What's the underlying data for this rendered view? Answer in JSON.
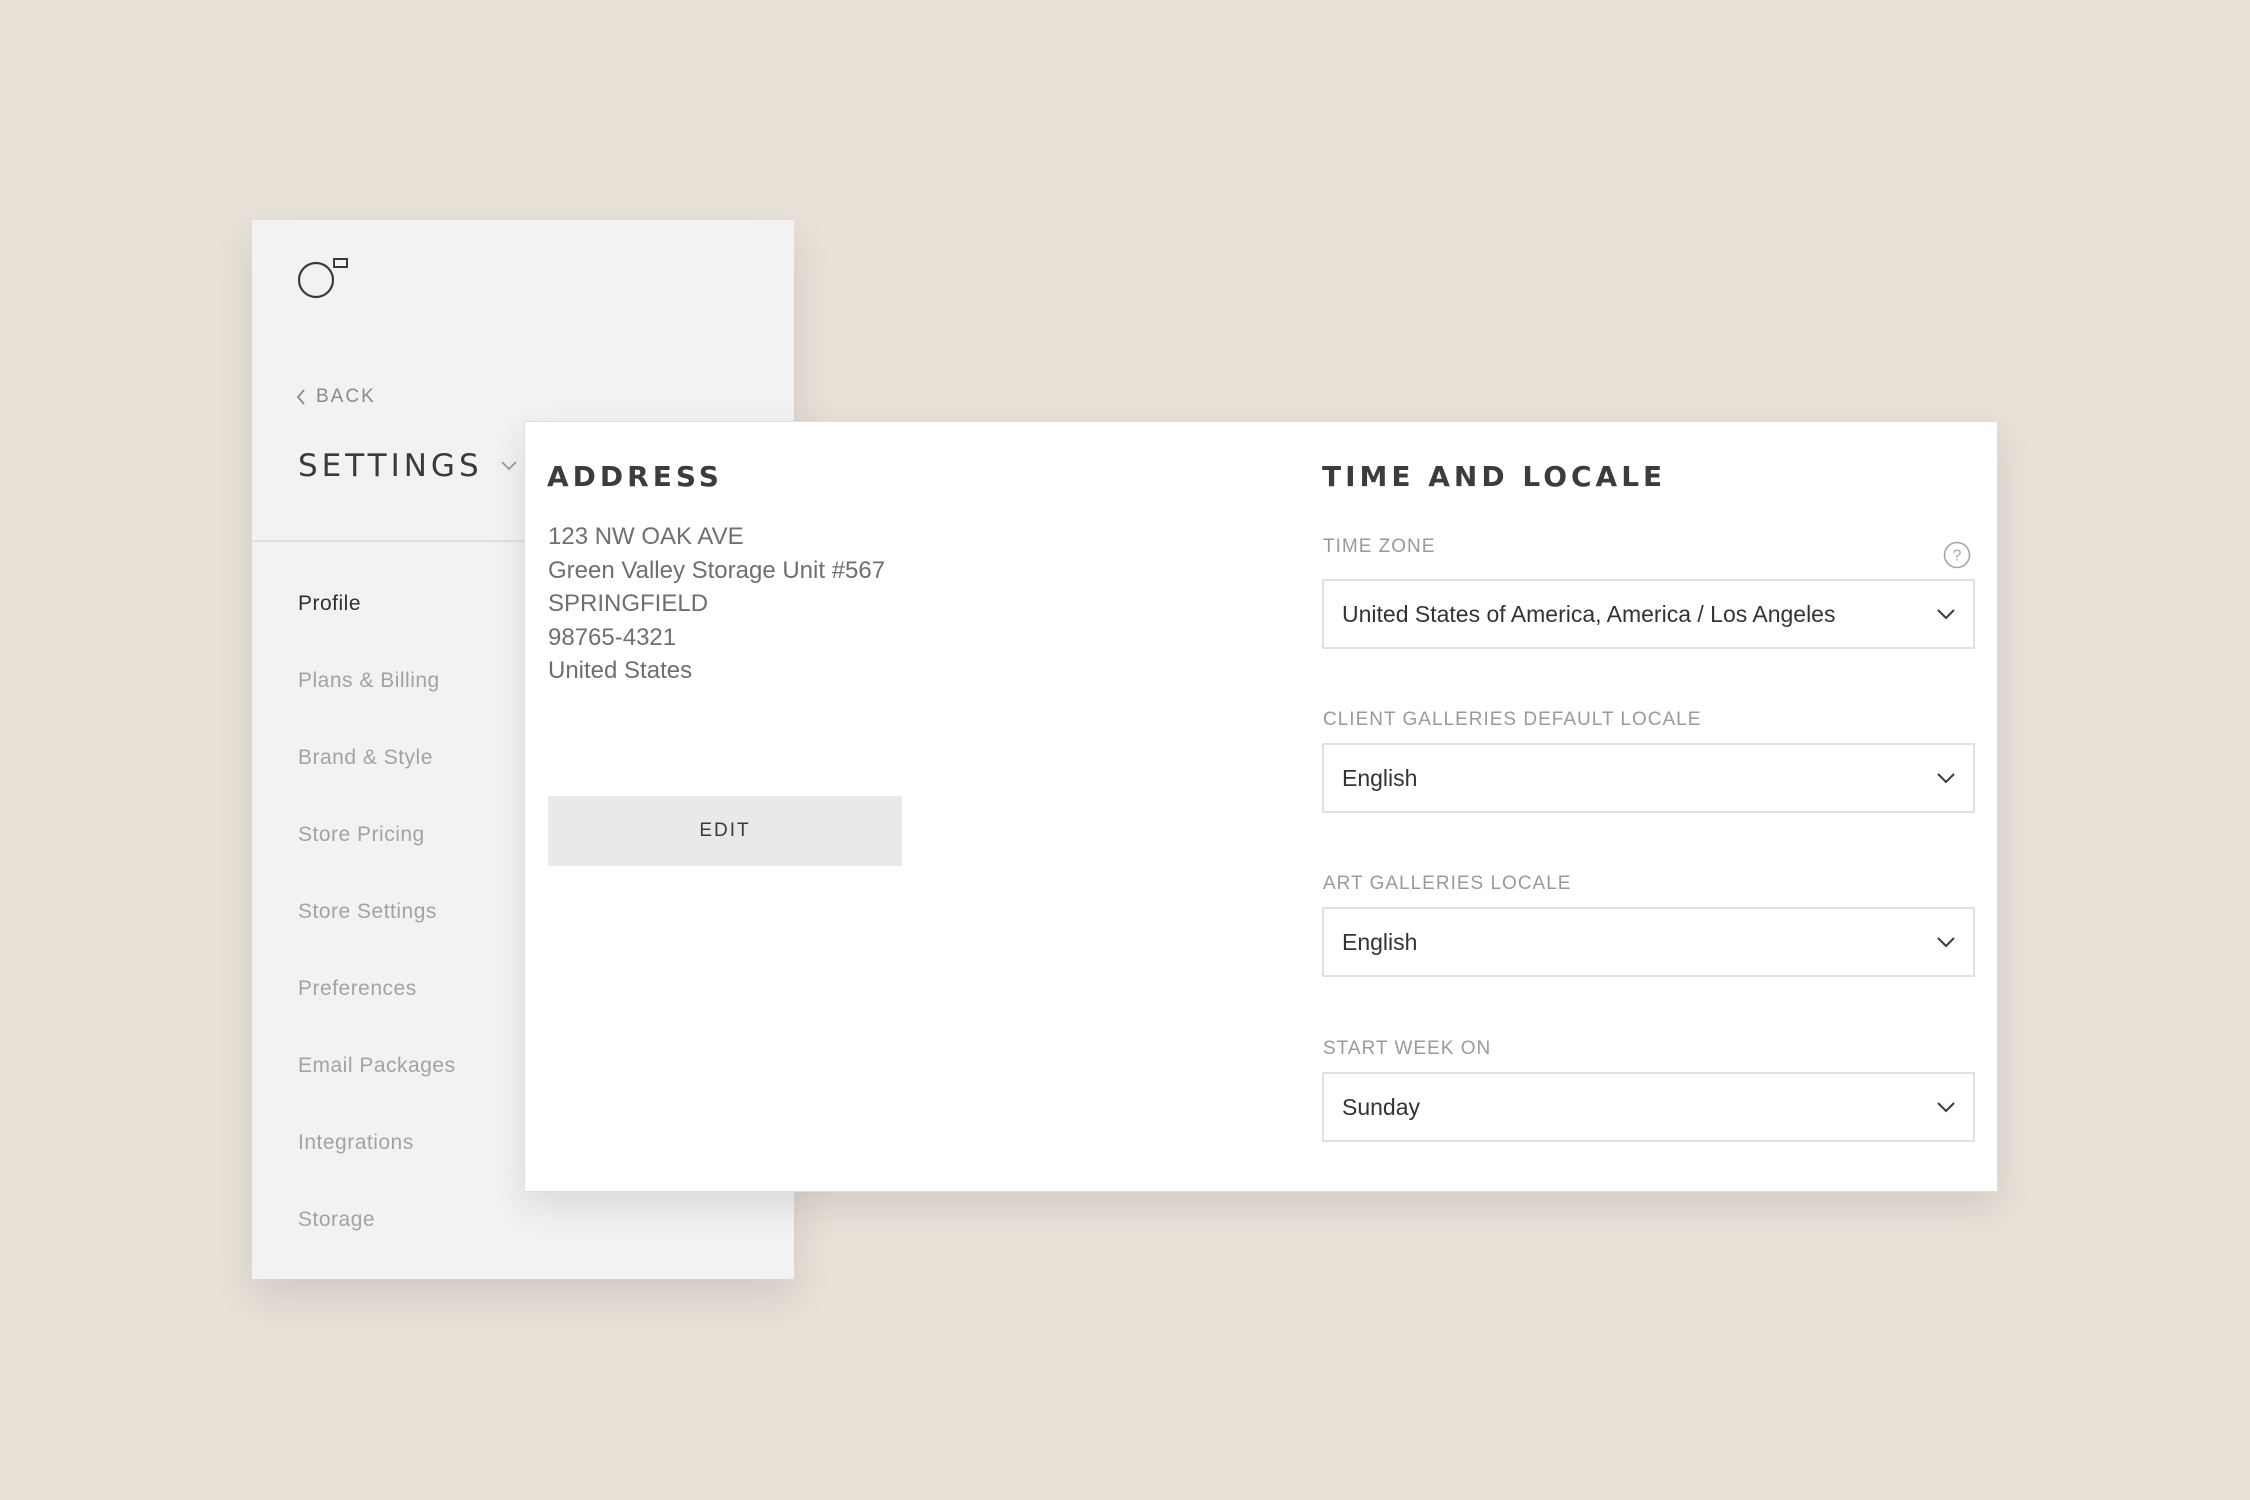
{
  "sidebar": {
    "logo": "brand-logo-icon",
    "back_label": "BACK",
    "title": "SETTINGS",
    "items": [
      {
        "label": "Profile",
        "active": true
      },
      {
        "label": "Plans & Billing",
        "active": false
      },
      {
        "label": "Brand & Style",
        "active": false
      },
      {
        "label": "Store Pricing",
        "active": false
      },
      {
        "label": "Store Settings",
        "active": false
      },
      {
        "label": "Preferences",
        "active": false
      },
      {
        "label": "Email Packages",
        "active": false
      },
      {
        "label": "Integrations",
        "active": false
      },
      {
        "label": "Storage",
        "active": false
      }
    ]
  },
  "address": {
    "heading": "ADDRESS",
    "lines": [
      "123 NW OAK AVE",
      "Green Valley Storage Unit #567",
      "SPRINGFIELD",
      "98765-4321",
      "United States"
    ],
    "edit_label": "EDIT"
  },
  "locale": {
    "heading": "TIME AND LOCALE",
    "time_zone": {
      "label": "TIME ZONE",
      "value": "United States of America, America / Los Angeles"
    },
    "client_galleries_locale": {
      "label": "CLIENT GALLERIES DEFAULT LOCALE",
      "value": "English"
    },
    "art_galleries_locale": {
      "label": "ART GALLERIES LOCALE",
      "value": "English"
    },
    "start_week_on": {
      "label": "START WEEK ON",
      "value": "Sunday"
    }
  },
  "colors": {
    "background": "#e8e1d8",
    "sidebar": "#f2f2f2",
    "panel": "#ffffff",
    "button": "#e9e9e9"
  }
}
